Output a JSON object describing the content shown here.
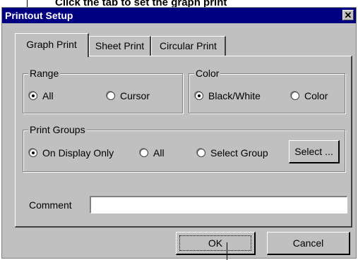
{
  "caption": {
    "text": "Click the tab to set the graph print",
    "pointer_note": ""
  },
  "dialog": {
    "title": "Printout Setup",
    "close_symbol": "✕"
  },
  "tabs": [
    {
      "label": "Graph Print",
      "active": true
    },
    {
      "label": "Sheet Print",
      "active": false
    },
    {
      "label": "Circular Print",
      "active": false
    }
  ],
  "range": {
    "legend": "Range",
    "options": [
      {
        "label": "All",
        "selected": true
      },
      {
        "label": "Cursor",
        "selected": false
      }
    ]
  },
  "color": {
    "legend": "Color",
    "options": [
      {
        "label": "Black/White",
        "selected": true
      },
      {
        "label": "Color",
        "selected": false
      }
    ]
  },
  "print_groups": {
    "legend": "Print Groups",
    "options": [
      {
        "label": "On Display Only",
        "selected": true
      },
      {
        "label": "All",
        "selected": false
      },
      {
        "label": "Select Group",
        "selected": false
      }
    ],
    "select_button": "Select ..."
  },
  "comment": {
    "label": "Comment",
    "value": ""
  },
  "footer": {
    "ok_label": "OK",
    "cancel_label": "Cancel"
  }
}
